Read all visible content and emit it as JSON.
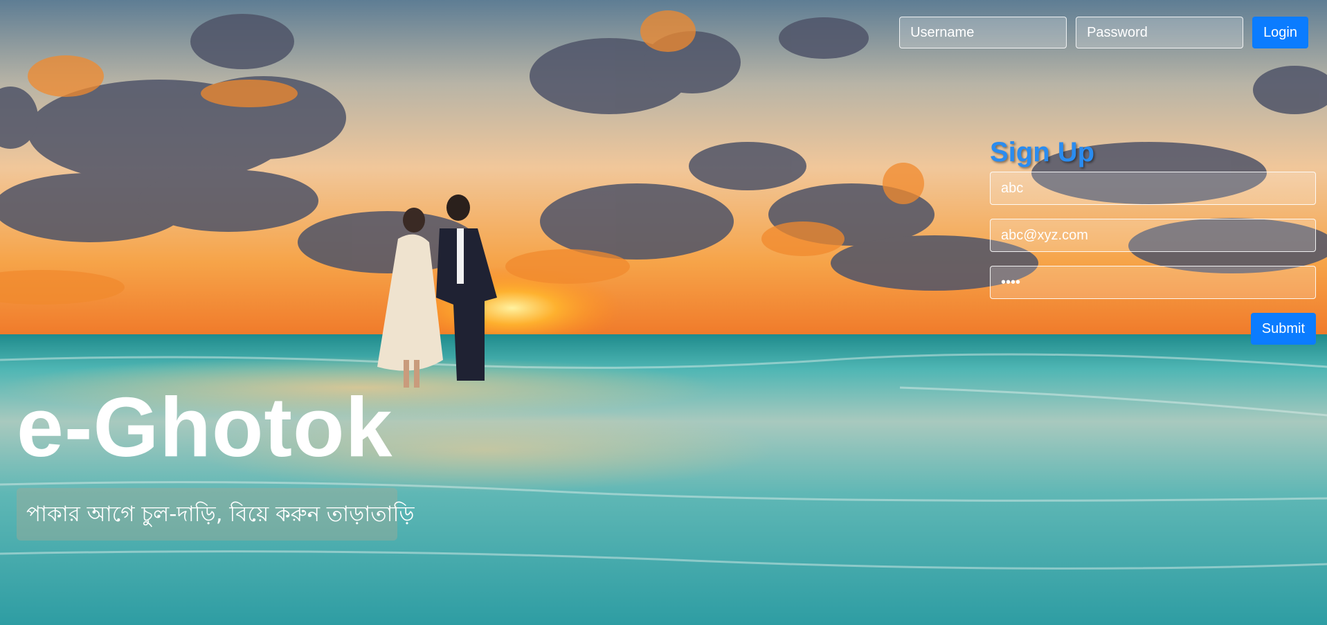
{
  "header": {
    "username_placeholder": "Username",
    "password_placeholder": "Password",
    "login_label": "Login"
  },
  "signup": {
    "title": "Sign Up",
    "name_value": "abc",
    "email_value": "abc@xyz.com",
    "password_value": "abcd",
    "submit_label": "Submit"
  },
  "hero": {
    "brand": "e-Ghotok",
    "tagline": "পাকার আগে চুল-দাড়ি, বিয়ে করুন তাড়াতাড়ি"
  },
  "colors": {
    "accent": "#0b7cff",
    "signup_title": "#2a8cf0"
  }
}
